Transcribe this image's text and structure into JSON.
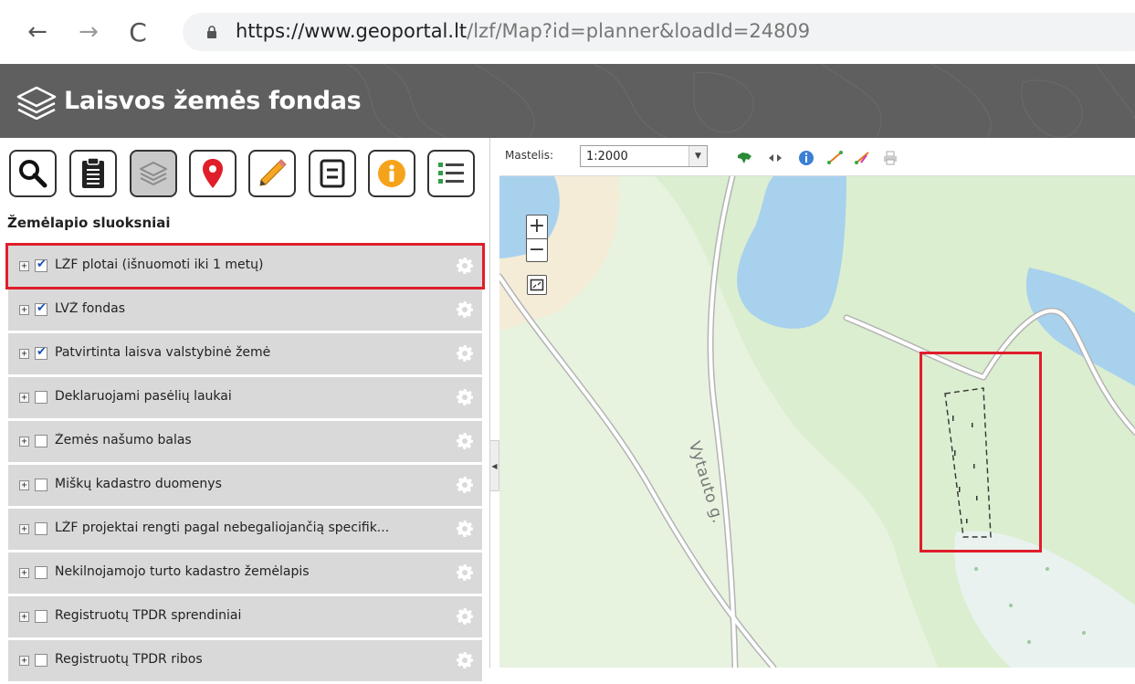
{
  "browser": {
    "back_glyph": "←",
    "forward_glyph": "→",
    "reload_glyph": "C",
    "url_host": "https://www.geoportal.lt",
    "url_path": "/lzf/Map?id=planner&loadId=24809"
  },
  "header": {
    "title": "Laisvos žemės fondas"
  },
  "toolbar": {
    "icons": [
      "search-icon",
      "clipboard-icon",
      "layers-icon",
      "map-marker-icon",
      "pencil-icon",
      "form-icon",
      "info-icon",
      "list-icon"
    ],
    "active": "layers-icon"
  },
  "panel": {
    "heading": "Žemėlapio sluoksniai"
  },
  "layers": [
    {
      "label": "LŽF plotai (išnuomoti iki 1 metų)",
      "checked": true,
      "expand": "+"
    },
    {
      "label": "LVŽ fondas",
      "checked": true,
      "expand": "+"
    },
    {
      "label": "Patvirtinta laisva valstybinė žemė",
      "checked": true,
      "expand": "+"
    },
    {
      "label": "Deklaruojami pasėlių laukai",
      "checked": false,
      "expand": "+"
    },
    {
      "label": "Žemės našumo balas",
      "checked": false,
      "expand": "+"
    },
    {
      "label": "Miškų kadastro duomenys",
      "checked": false,
      "expand": "+"
    },
    {
      "label": "LŽF projektai rengti pagal nebegaliojančią specifik...",
      "checked": false,
      "expand": "+"
    },
    {
      "label": "Nekilnojamojo turto kadastro žemėlapis",
      "checked": false,
      "expand": "+"
    },
    {
      "label": "Registruotų TPDR sprendiniai",
      "checked": false,
      "expand": "+"
    },
    {
      "label": "Registruotų TPDR ribos",
      "checked": false,
      "expand": "+"
    }
  ],
  "map": {
    "scale_label": "Mastelis:",
    "scale_value": "1:2000",
    "zoom_in": "+",
    "zoom_out": "−",
    "street_name": "Vytauto g."
  },
  "colors": {
    "highlight": "#e01d2b",
    "header_bg": "#5f5f5f",
    "map_green": "#dbeed0",
    "water": "#a8d1ee"
  }
}
